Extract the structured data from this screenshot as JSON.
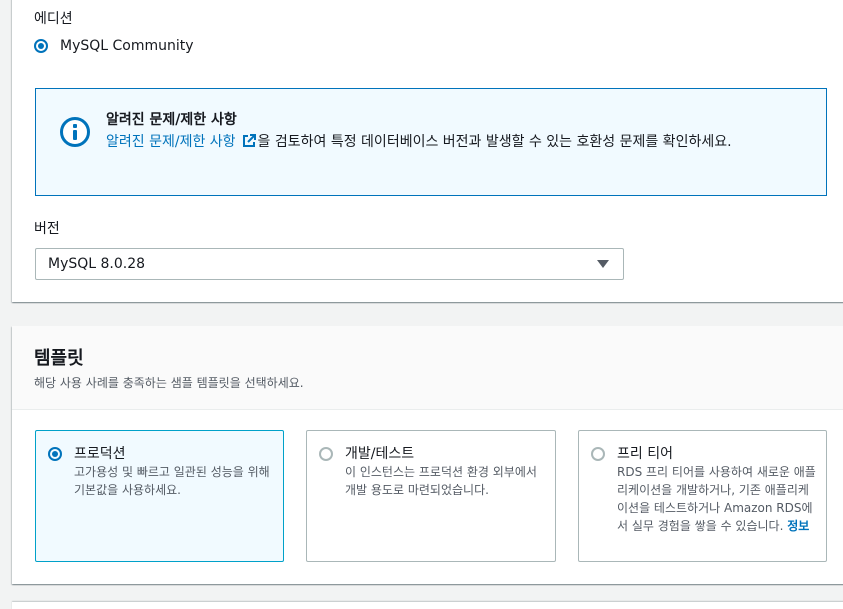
{
  "engine": {
    "edition_label": "에디션",
    "edition_option": "MySQL Community"
  },
  "alert": {
    "title": "알려진 문제/제한 사항",
    "link_text": "알려진 문제/제한 사항",
    "body_text": "을 검토하여 특정 데이터베이스 버전과 발생할 수 있는 호환성 문제를 확인하세요."
  },
  "version": {
    "label": "버전",
    "selected": "MySQL 8.0.28"
  },
  "templates": {
    "title": "템플릿",
    "description": "해당 사용 사례를 충족하는 샘플 템플릿을 선택하세요.",
    "options": [
      {
        "title": "프로덕션",
        "description": "고가용성 및 빠르고 일관된 성능을 위해 기본값을 사용하세요.",
        "selected": true
      },
      {
        "title": "개발/테스트",
        "description": "이 인스턴스는 프로덕션 환경 외부에서 개발 용도로 마련되었습니다.",
        "selected": false
      },
      {
        "title": "프리 티어",
        "description": "RDS 프리 티어를 사용하여 새로운 애플리케이션을 개발하거나, 기존 애플리케이션을 테스트하거나 Amazon RDS에서 실무 경험을 쌓을 수 있습니다.",
        "info_link": "정보",
        "selected": false
      }
    ]
  },
  "colors": {
    "accent": "#0073bb",
    "alert_bg": "#f1faff",
    "selected_tile_border": "#00a1c9"
  }
}
